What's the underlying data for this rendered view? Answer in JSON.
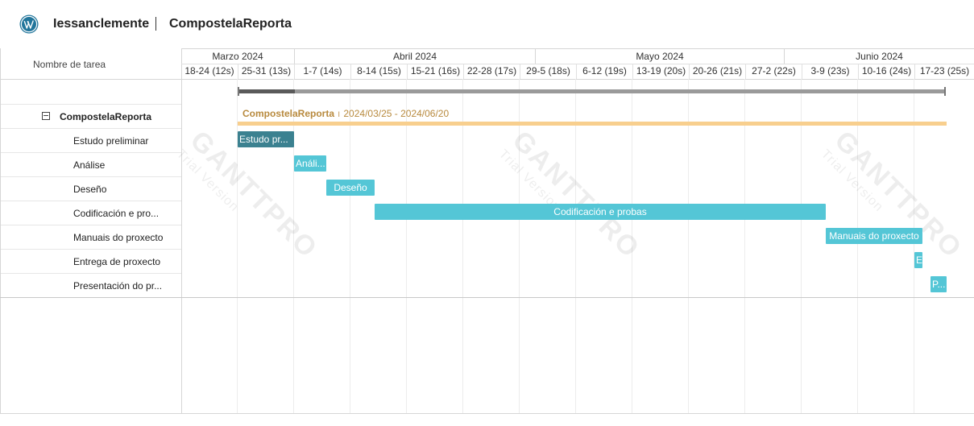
{
  "header": {
    "organization": "Iessanclemente",
    "project_name": "CompostelaReporta"
  },
  "left_panel": {
    "column_header": "Nombre de tarea",
    "project_row": {
      "label": "CompostelaReporta"
    },
    "tasks": [
      {
        "label": "Estudo preliminar"
      },
      {
        "label": "Análise"
      },
      {
        "label": "Deseño"
      },
      {
        "label": "Codificación e pro..."
      },
      {
        "label": "Manuais do proxecto"
      },
      {
        "label": "Entrega de proxecto"
      },
      {
        "label": "Presentación do pr..."
      }
    ]
  },
  "timeline": {
    "months": [
      "Marzo 2024",
      "Abril 2024",
      "Mayo 2024",
      "Junio 2024"
    ],
    "weeks": [
      "18-24 (12s)",
      "25-31 (13s)",
      "1-7 (14s)",
      "8-14 (15s)",
      "15-21 (16s)",
      "22-28 (17s)",
      "29-5 (18s)",
      "6-12 (19s)",
      "13-19 (20s)",
      "20-26 (21s)",
      "27-2 (22s)",
      "3-9 (23s)",
      "10-16 (24s)",
      "17-23 (25s)"
    ]
  },
  "project_bar": {
    "name": "CompostelaReporta",
    "dates": "2024/03/25 - 2024/06/20",
    "color": "#f8cf8e"
  },
  "bars": [
    {
      "text": "Estudo pr...",
      "color": "#3b8190"
    },
    {
      "text": "Análi...",
      "color": "#54c6d6"
    },
    {
      "text": "Deseño",
      "color": "#54c6d6"
    },
    {
      "text": "Codificación e probas",
      "color": "#54c6d6"
    },
    {
      "text": "Manuais do proxecto",
      "color": "#54c6d6"
    },
    {
      "text": "E",
      "color": "#54c6d6"
    },
    {
      "text": "P...",
      "color": "#54c6d6"
    }
  ],
  "watermarks": [
    {
      "brand": "GANTTPRO",
      "note": "Trial Version"
    },
    {
      "brand": "GANTTPRO",
      "note": "Trial Version"
    },
    {
      "brand": "GANTTPRO",
      "note": "Trial Version"
    }
  ]
}
